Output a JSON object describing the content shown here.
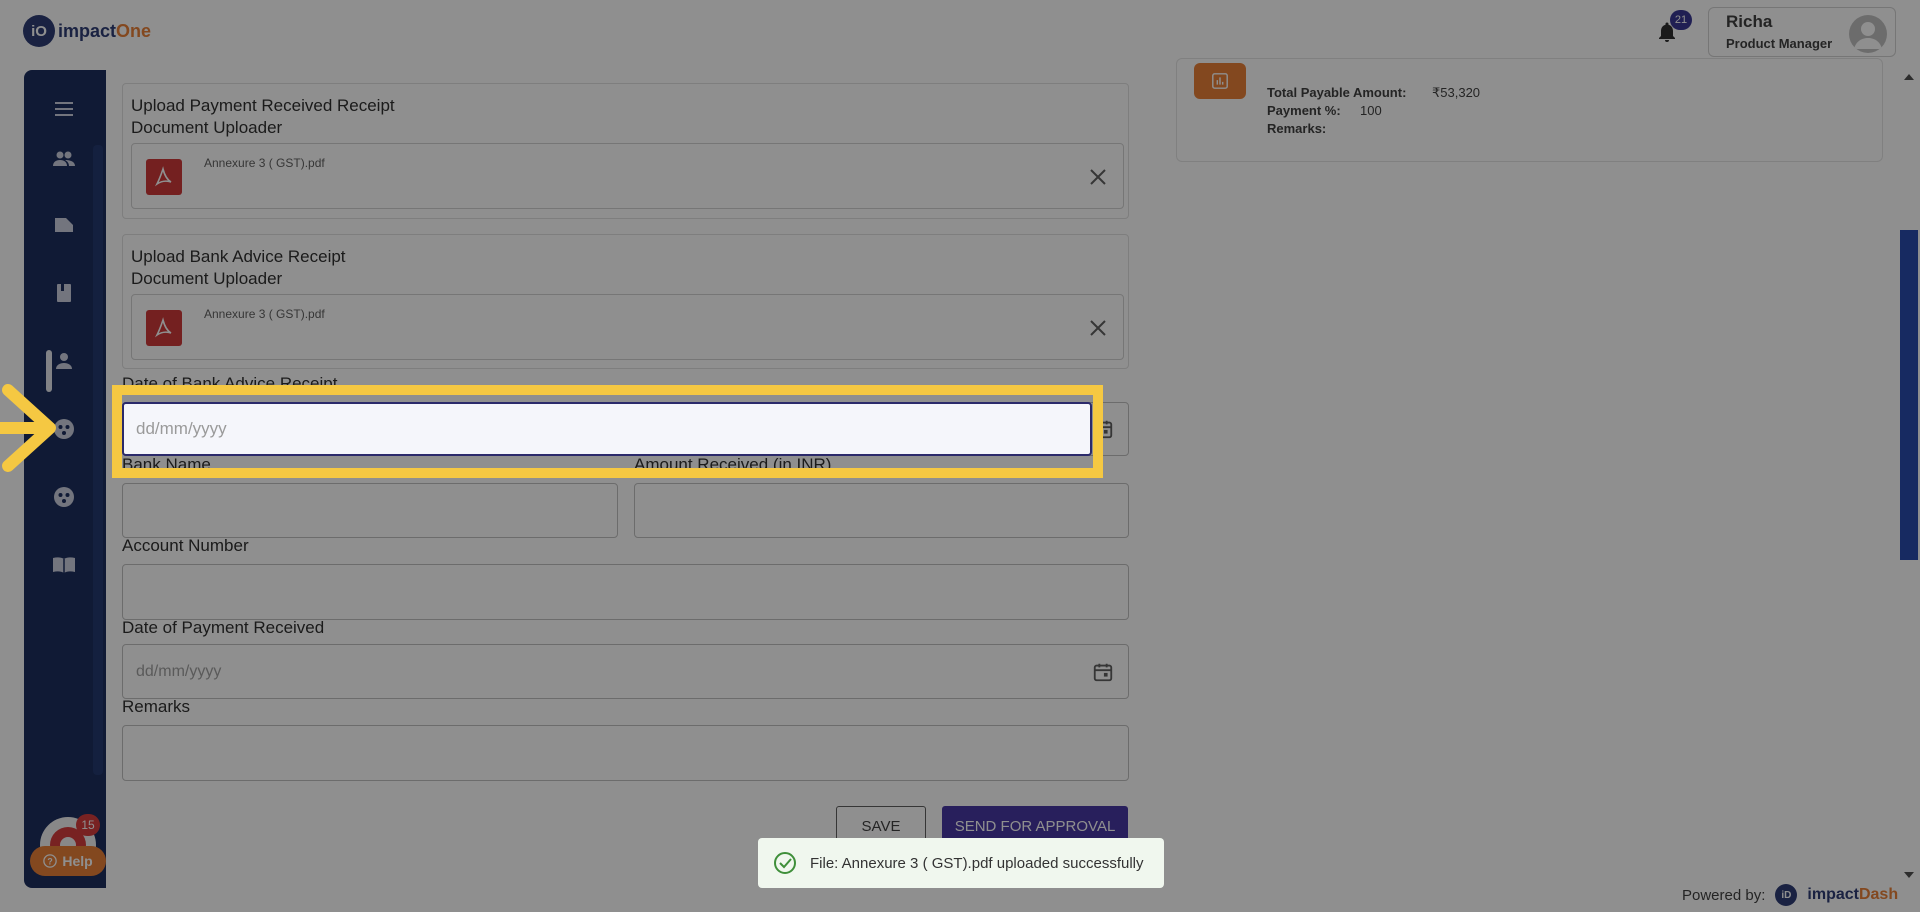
{
  "header": {
    "logo_mark": "iO",
    "logo_part1": "impact",
    "logo_part2": "One",
    "notification_count": "21",
    "user_name": "Richa",
    "user_role": "Product Manager"
  },
  "sidebar": {
    "icons": [
      "menu-icon",
      "people-icon",
      "folder-icon",
      "book-icon",
      "person-icon",
      "group-icon",
      "group-icon",
      "manual-icon"
    ],
    "avatar_badge": "15",
    "help_label": "Help"
  },
  "form": {
    "payment_receipt": {
      "title": "Upload Payment Received Receipt",
      "subtitle": "Document Uploader",
      "file_name": "Annexure 3 ( GST).pdf"
    },
    "bank_advice": {
      "title": "Upload Bank Advice Receipt",
      "subtitle": "Document Uploader",
      "file_name": "Annexure 3 ( GST).pdf"
    },
    "date_bank_advice": {
      "label": "Date of Bank Advice Receipt",
      "placeholder": "dd/mm/yyyy"
    },
    "bank_name_label": "Bank Name",
    "amount_received_label": "Amount Received (in INR)",
    "account_number_label": "Account Number",
    "date_payment": {
      "label": "Date of Payment Received",
      "placeholder": "dd/mm/yyyy"
    },
    "remarks_label": "Remarks",
    "save_label": "SAVE",
    "send_label": "SEND FOR APPROVAL"
  },
  "summary": {
    "total_label": "Total Payable Amount:",
    "total_value": "₹53,320",
    "payment_pct_label": "Payment %:",
    "payment_pct_value": "100",
    "remarks_label": "Remarks:"
  },
  "toast": {
    "message": "File: Annexure 3 ( GST).pdf uploaded successfully"
  },
  "footer": {
    "powered_label": "Powered by:",
    "brand_mark": "iD",
    "brand_part1": "impact",
    "brand_part2": "Dash"
  },
  "colors": {
    "sidebar": "#0d2054",
    "accent_orange": "#e8782a",
    "primary_button": "#3b2a9e",
    "highlight": "#f5c842"
  }
}
